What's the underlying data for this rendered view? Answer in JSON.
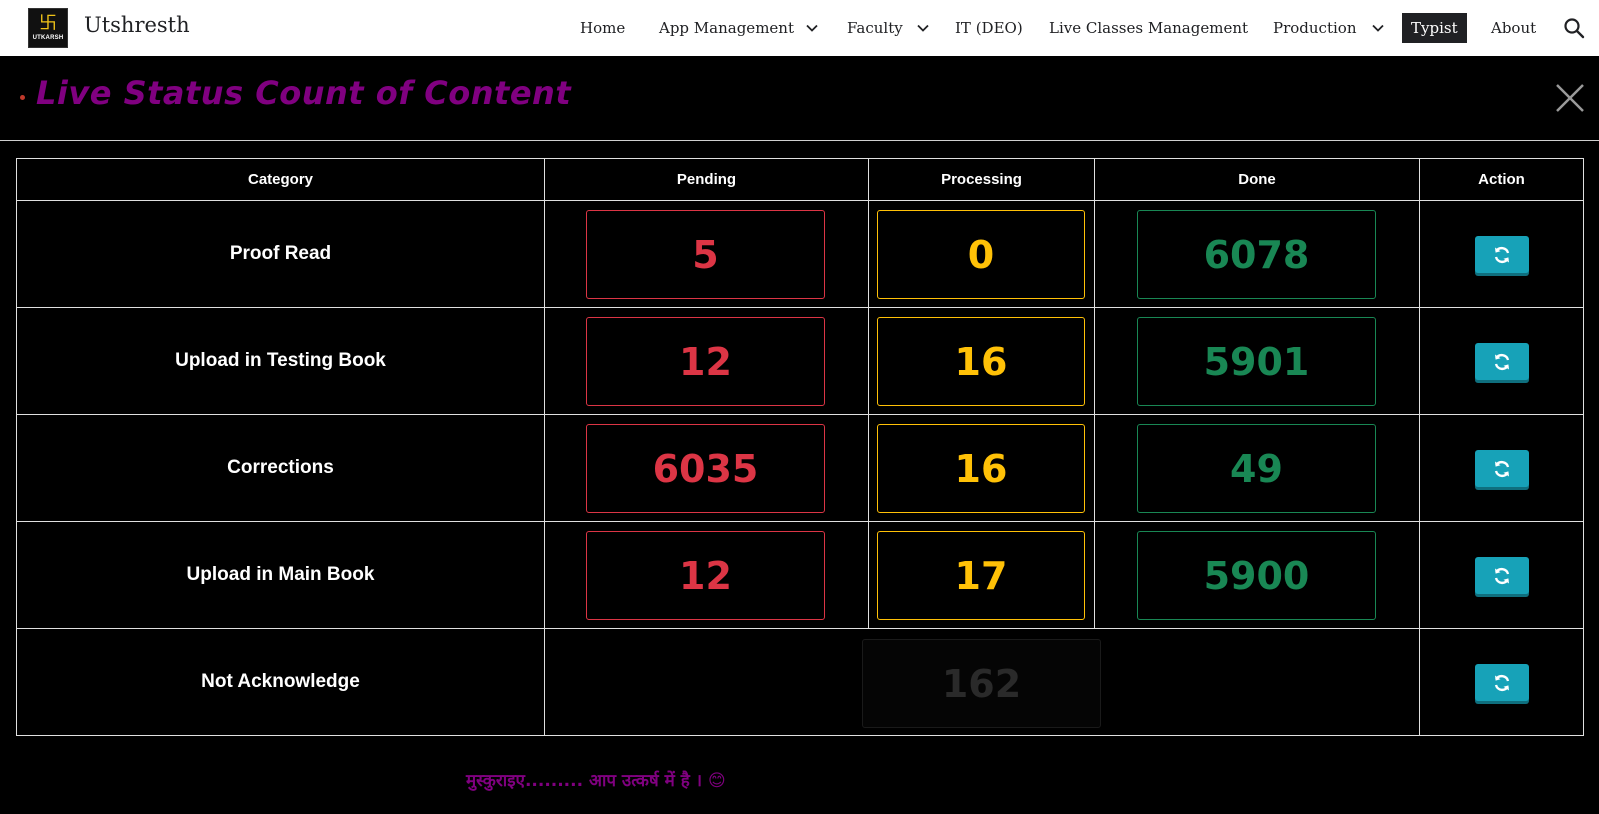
{
  "site": {
    "logo_text": "UTKARSH",
    "logo_mark": "卐",
    "title": "Utshresth"
  },
  "nav": {
    "items": [
      {
        "label": "Home",
        "has_dropdown": false
      },
      {
        "label": "App Management",
        "has_dropdown": true
      },
      {
        "label": "Faculty",
        "has_dropdown": true
      },
      {
        "label": "IT (DEO)",
        "has_dropdown": false
      },
      {
        "label": "Live Classes Management",
        "has_dropdown": false
      },
      {
        "label": "Production",
        "has_dropdown": true
      },
      {
        "label": "Typist",
        "has_dropdown": false,
        "active": true
      },
      {
        "label": "About",
        "has_dropdown": false
      }
    ],
    "search_icon": "search-icon"
  },
  "dialog": {
    "title": "Live Status Count of Content",
    "close_icon": "close-icon"
  },
  "table": {
    "headers": {
      "category": "Category",
      "pending": "Pending",
      "processing": "Processing",
      "done": "Done",
      "action": "Action"
    },
    "rows": [
      {
        "category": "Proof Read",
        "pending": "5",
        "processing": "0",
        "done": "6078"
      },
      {
        "category": "Upload in Testing Book",
        "pending": "12",
        "processing": "16",
        "done": "5901"
      },
      {
        "category": "Corrections",
        "pending": "6035",
        "processing": "16",
        "done": "49"
      },
      {
        "category": "Upload in Main Book",
        "pending": "12",
        "processing": "17",
        "done": "5900"
      }
    ],
    "last_row": {
      "category": "Not Acknowledge",
      "count": "162"
    },
    "action_icon": "refresh-icon"
  },
  "colors": {
    "pending": "#dc3545",
    "processing": "#ffc107",
    "done": "#198754",
    "title": "#800080",
    "action_button": "#17a2b8"
  },
  "footer": {
    "message": "मुस्कुराइए......... आप उत्कर्ष में है । 😊"
  }
}
